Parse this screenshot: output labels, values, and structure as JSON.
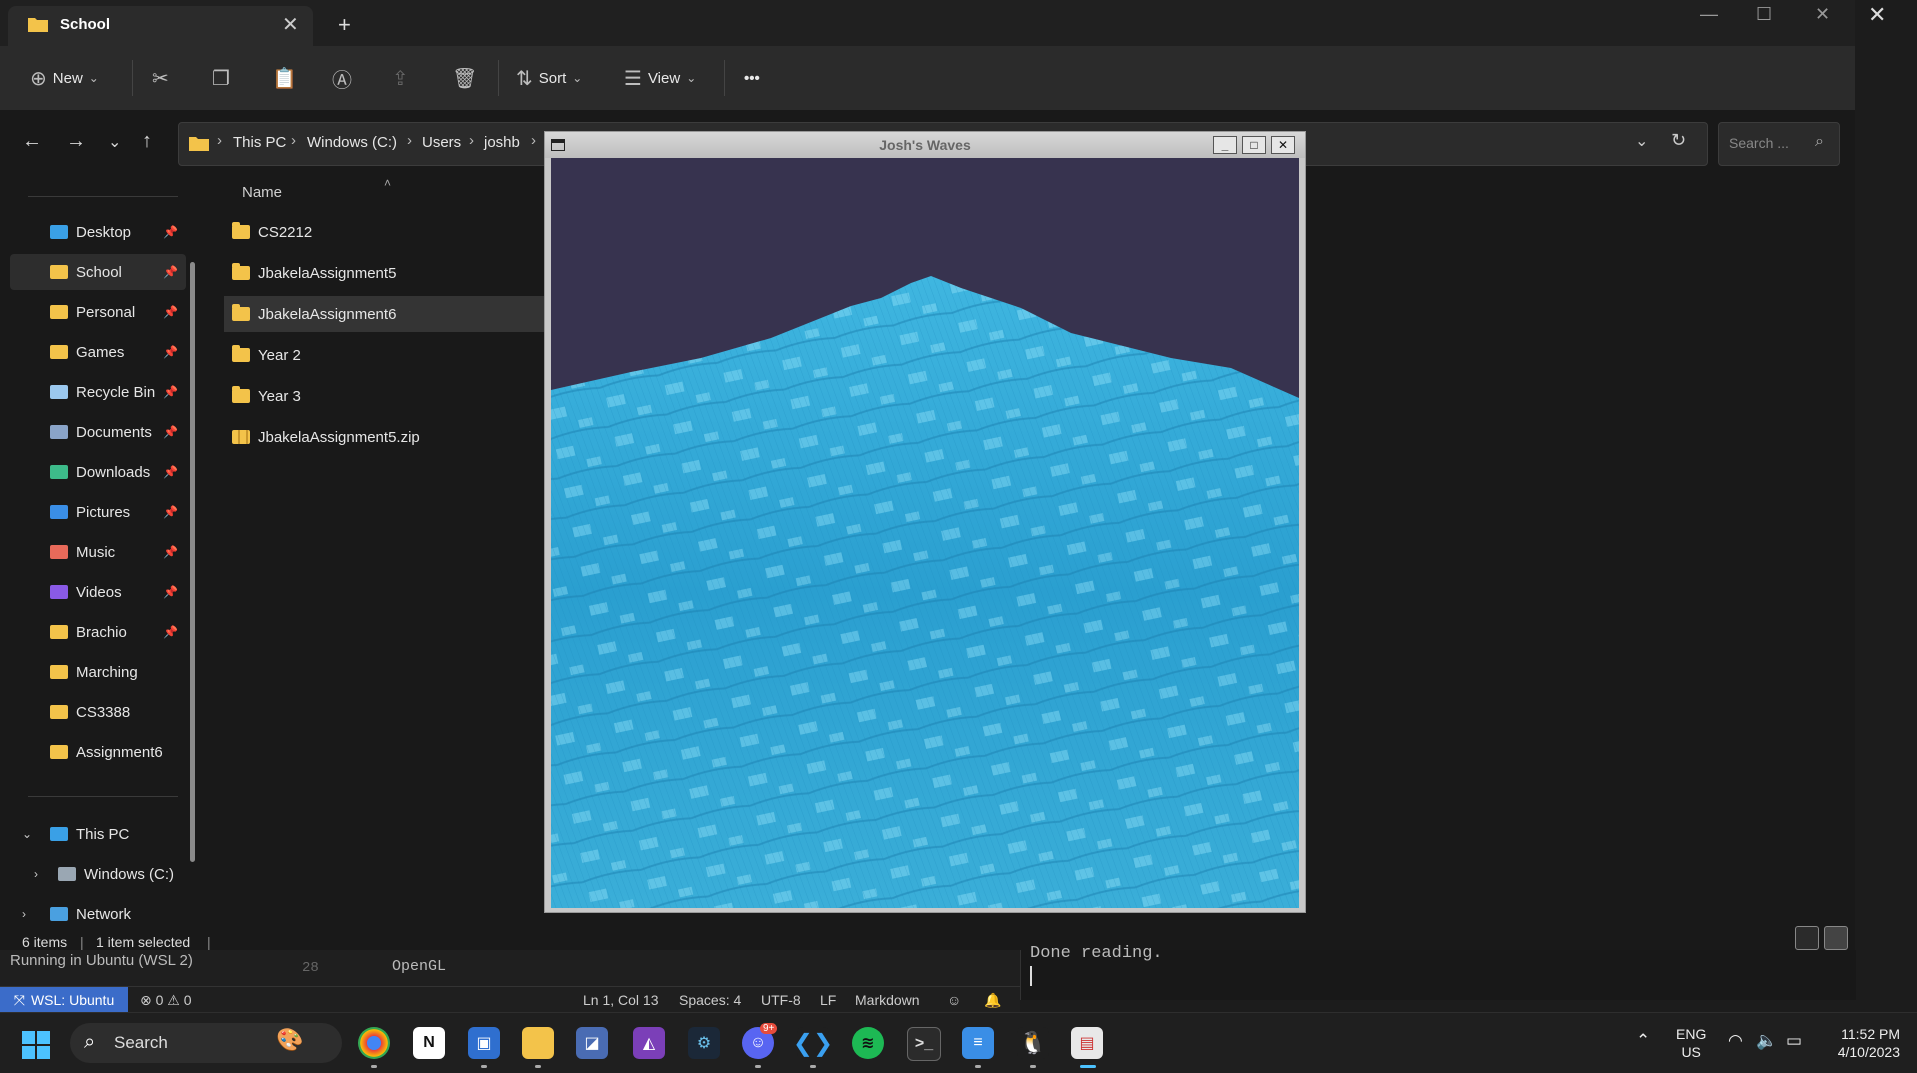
{
  "explorer": {
    "tab_title": "School",
    "tab_close": "✕",
    "tab_add": "+",
    "toolbar": {
      "new_label": "New",
      "sort_label": "Sort",
      "view_label": "View",
      "more_label": "•••"
    },
    "breadcrumbs": [
      "This PC",
      "Windows (C:)",
      "Users",
      "joshb"
    ],
    "search_placeholder": "Search ...",
    "sidebar": {
      "quick_access": [
        {
          "label": "Desktop",
          "icon": "desktop-icon",
          "color": "#3aa0e6"
        },
        {
          "label": "School",
          "icon": "folder-icon",
          "color": "#f3c34a"
        },
        {
          "label": "Personal",
          "icon": "folder-icon",
          "color": "#f3c34a"
        },
        {
          "label": "Games",
          "icon": "folder-icon",
          "color": "#f3c34a"
        },
        {
          "label": "Recycle Bin",
          "icon": "recycle-bin-icon",
          "color": "#9bc8ee"
        },
        {
          "label": "Documents",
          "icon": "documents-icon",
          "color": "#8aa4c8"
        },
        {
          "label": "Downloads",
          "icon": "downloads-icon",
          "color": "#3dbb8a"
        },
        {
          "label": "Pictures",
          "icon": "pictures-icon",
          "color": "#3a8ee6"
        },
        {
          "label": "Music",
          "icon": "music-icon",
          "color": "#e86a5a"
        },
        {
          "label": "Videos",
          "icon": "videos-icon",
          "color": "#8a5ae6"
        },
        {
          "label": "Brachio",
          "icon": "folder-icon",
          "color": "#f3c34a"
        },
        {
          "label": "Marching",
          "icon": "folder-icon",
          "color": "#f3c34a"
        },
        {
          "label": "CS3388",
          "icon": "folder-icon",
          "color": "#f3c34a"
        },
        {
          "label": "Assignment6",
          "icon": "folder-icon",
          "color": "#f3c34a"
        }
      ],
      "this_pc": "This PC",
      "windows_c": "Windows (C:)",
      "network": "Network"
    },
    "file_list": {
      "column_name": "Name",
      "files": [
        {
          "name": "CS2212",
          "type": "folder"
        },
        {
          "name": "JbakelaAssignment5",
          "type": "folder"
        },
        {
          "name": "JbakelaAssignment6",
          "type": "folder"
        },
        {
          "name": "Year 2",
          "type": "folder"
        },
        {
          "name": "Year 3",
          "type": "folder"
        },
        {
          "name": "JbakelaAssignment5.zip",
          "type": "zip"
        }
      ]
    },
    "status": {
      "items": "6 items",
      "selected": "1 item selected"
    }
  },
  "gl_window": {
    "title": "Josh's Waves",
    "minimize": "_",
    "maximize": "□",
    "close": "✕",
    "sky_color": "#37334f",
    "water_color": "#2aa3d4"
  },
  "vscode": {
    "running_text": "Running in Ubuntu (WSL 2)",
    "line_number": "28",
    "code_text": "OpenGL",
    "terminal_text": "Done reading.",
    "wsl_badge": "WSL: Ubuntu",
    "problems": "⊗ 0 ⚠ 0",
    "cursor_pos": "Ln 1, Col 13",
    "spaces": "Spaces: 4",
    "encoding": "UTF-8",
    "eol": "LF",
    "language": "Markdown",
    "close_icon": "✕"
  },
  "taskbar": {
    "search_label": "Search",
    "language": "ENG",
    "region": "US",
    "time": "11:52 PM",
    "date": "4/10/2023",
    "discord_badge": "9+"
  }
}
